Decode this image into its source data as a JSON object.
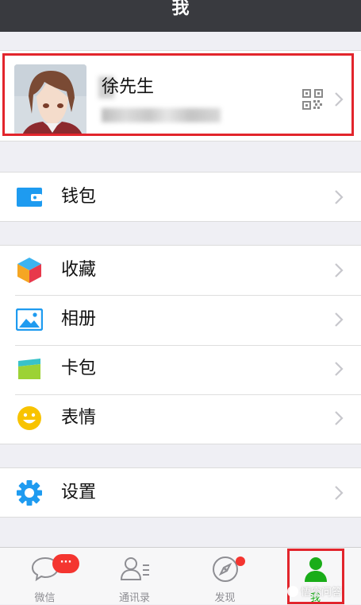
{
  "header": {
    "title": "我"
  },
  "profile": {
    "name": "徐先生",
    "id_text": "",
    "qr_icon": "qr-code-icon"
  },
  "menu": {
    "wallet": {
      "label": "钱包",
      "icon": "wallet-icon",
      "color": "#1E9BF0"
    },
    "favorites": {
      "label": "收藏",
      "icon": "favorites-cube-icon"
    },
    "album": {
      "label": "相册",
      "icon": "album-icon",
      "color": "#1E9BF0"
    },
    "card_pack": {
      "label": "卡包",
      "icon": "card-pack-icon"
    },
    "stickers": {
      "label": "表情",
      "icon": "smiley-icon",
      "color": "#F8C300"
    },
    "settings": {
      "label": "设置",
      "icon": "gear-icon",
      "color": "#1E9BF0"
    }
  },
  "tabbar": {
    "tabs": [
      {
        "label": "微信",
        "icon": "chat-bubble-icon",
        "badge": "···"
      },
      {
        "label": "通讯录",
        "icon": "contacts-icon"
      },
      {
        "label": "发现",
        "icon": "compass-icon",
        "dot": true
      },
      {
        "label": "我",
        "icon": "person-icon",
        "active": true
      }
    ],
    "active_color": "#1AAD19"
  },
  "watermark": {
    "text": "悟空问答"
  }
}
